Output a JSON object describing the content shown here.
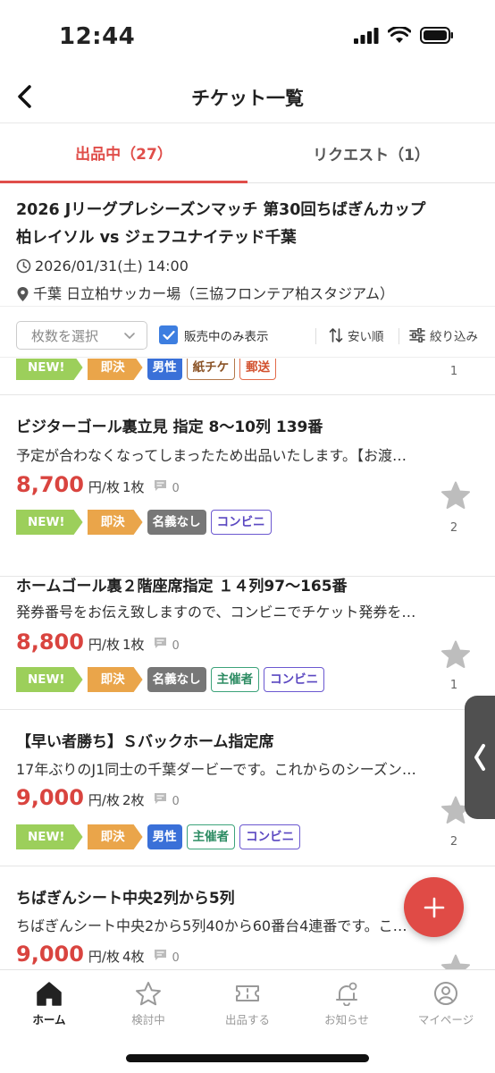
{
  "status": {
    "time": "12:44"
  },
  "nav": {
    "title": "チケット一覧"
  },
  "tabs": [
    {
      "label": "出品中（27）"
    },
    {
      "label": "リクエスト（1）"
    }
  ],
  "event": {
    "title_line1": "2026 Jリーグプレシーズンマッチ 第30回ちばぎんカップ",
    "title_line2": "柏レイソル vs ジェフユナイテッド千葉",
    "datetime": "2026/01/31(土) 14:00",
    "venue": "千葉 日立柏サッカー場（三協フロンテア柏スタジアム）"
  },
  "filters": {
    "quantity_placeholder": "枚数を選択",
    "on_sale_only_label": "販売中のみ表示",
    "on_sale_only_checked": true,
    "sort_label": "安い順",
    "filter_label": "絞り込み"
  },
  "listings": [
    {
      "tags": [
        "NEW!",
        "即決",
        "男性",
        "紙チケ",
        "郵送"
      ],
      "favorite_count": "1"
    },
    {
      "title": "ビジターゴール裏立見 指定 8〜10列 139番",
      "description": "予定が合わなくなってしまったため出品いたします。【お渡…",
      "price": "8,700",
      "unit": "円/枚",
      "quantity": "1枚",
      "comments": "0",
      "tags": [
        "NEW!",
        "即決",
        "名義なし",
        "コンビニ"
      ],
      "favorite_count": "2"
    },
    {
      "title": "ホームゴール裏２階座席指定 １４列97〜165番",
      "description": "発券番号をお伝え致しますので、コンビニでチケット発券を…",
      "price": "8,800",
      "unit": "円/枚",
      "quantity": "1枚",
      "comments": "0",
      "tags": [
        "NEW!",
        "即決",
        "名義なし",
        "主催者",
        "コンビニ"
      ],
      "favorite_count": "1"
    },
    {
      "title": "【早い者勝ち】Ｓバックホーム指定席",
      "description": "17年ぶりのJ1同士の千葉ダービーです。これからのシーズン…",
      "price": "9,000",
      "unit": "円/枚",
      "quantity": "2枚",
      "comments": "0",
      "tags": [
        "NEW!",
        "即決",
        "男性",
        "主催者",
        "コンビニ"
      ],
      "favorite_count": "2"
    },
    {
      "title": "ちばぎんシート中央2列から5列",
      "description": "ちばぎんシート中央2から5列40から60番台4連番です。こ…",
      "price": "9,000",
      "unit": "円/枚",
      "quantity": "4枚",
      "comments": "0"
    }
  ],
  "fab": {
    "icon": "plus-icon"
  },
  "tabbar": [
    {
      "label": "ホーム",
      "icon": "home-icon",
      "active": true
    },
    {
      "label": "検討中",
      "icon": "star-icon"
    },
    {
      "label": "出品する",
      "icon": "ticket-icon"
    },
    {
      "label": "お知らせ",
      "icon": "bell-icon"
    },
    {
      "label": "マイページ",
      "icon": "user-icon"
    }
  ],
  "colors": {
    "accent": "#e04e4a",
    "price": "#d9443f",
    "new_tag": "#9ccf5b",
    "instant_tag": "#eaa54a",
    "male_tag": "#3a70d8",
    "no_name_tag": "#777777",
    "checkbox": "#3d7ee0"
  }
}
